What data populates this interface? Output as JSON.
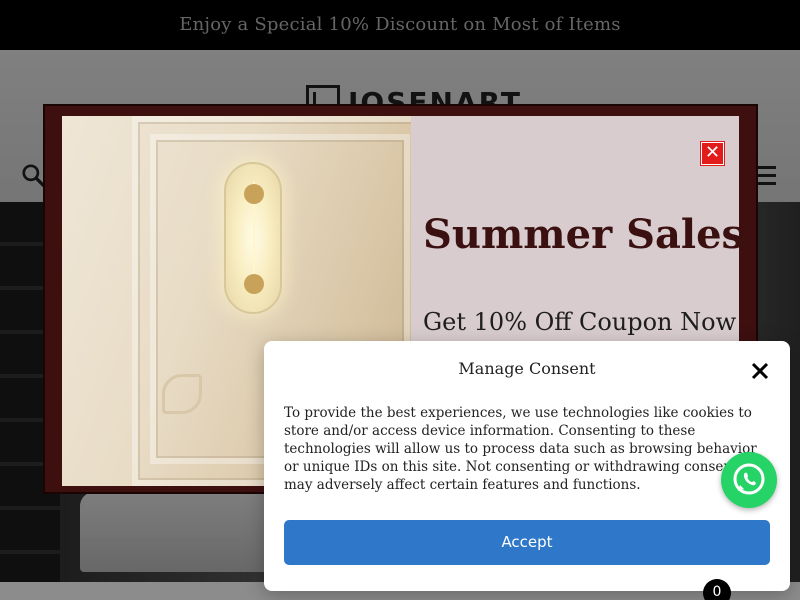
{
  "announcement": {
    "text": "Enjoy a Special 10% Discount on Most of Items"
  },
  "header": {
    "logo_text": "JOSENART"
  },
  "popup": {
    "title": "Summer Sales",
    "subtitle": "Get 10% Off Coupon Now",
    "close_label": "✕"
  },
  "consent": {
    "title": "Manage Consent",
    "body": "To provide the best experiences, we use technologies like cookies to store and/or access device information. Consenting to these technologies will allow us to process data such as browsing behavior or unique IDs on this site. Not consenting or withdrawing consent, may adversely affect certain features and functions.",
    "accept_label": "Accept"
  },
  "cart": {
    "count": "0"
  },
  "colors": {
    "accent_blue": "#2f78c9",
    "popup_border": "#3d0f0f",
    "close_red": "#e21b1b",
    "whatsapp_green": "#25d366"
  },
  "icons": [
    "search-icon",
    "menu-icon",
    "close-icon",
    "whatsapp-icon",
    "cart-icon"
  ]
}
